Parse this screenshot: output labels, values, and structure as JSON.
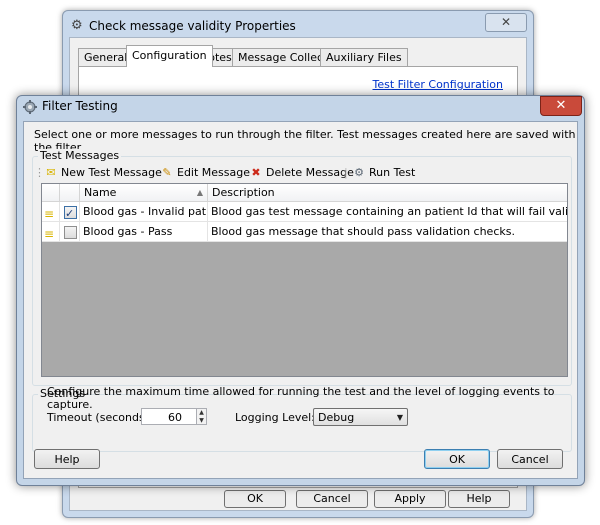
{
  "back_window": {
    "title": "Check message validity Properties",
    "close_glyph": "✕",
    "tabs": [
      "General",
      "Configuration",
      "Notes",
      "Message Collector",
      "Auxiliary Files"
    ],
    "link": "Test Filter Configuration",
    "buttons": [
      "OK",
      "Cancel",
      "Apply",
      "Help"
    ]
  },
  "dialog": {
    "title": "Filter Testing",
    "close_glyph": "✕",
    "intro": "Select one or more messages to run through the filter. Test messages created here are saved with the filter.",
    "test_messages_label": "Test Messages",
    "toolbar": {
      "new": "New Test Message",
      "edit": "Edit Message",
      "delete": "Delete Message",
      "run": "Run Test"
    },
    "grid": {
      "columns": [
        "Name",
        "Description"
      ],
      "rows": [
        {
          "checked": true,
          "name": "Blood gas - Invalid patient Id",
          "description": "Blood gas test message containing an patient Id that will fail validation rules."
        },
        {
          "checked": false,
          "name": "Blood gas - Pass",
          "description": "Blood gas message that should pass validation checks."
        }
      ]
    },
    "settings": {
      "label": "Settings",
      "description": "Configure the maximum time allowed for running the test and the level of logging events to capture.",
      "timeout_label": "Timeout (seconds):",
      "timeout_value": "60",
      "logging_label": "Logging Level:",
      "logging_value": "Debug"
    },
    "buttons": {
      "help": "Help",
      "ok": "OK",
      "cancel": "Cancel"
    }
  },
  "colors": {
    "title_bar": "#c4d5e8",
    "close_button": "#c94a3a",
    "link": "#0033cc",
    "grid_empty": "#a9a9a9"
  },
  "icons": [
    "gear-icon",
    "message-icon",
    "pencil-icon",
    "delete-icon",
    "run-icon",
    "sort-arrow-icon"
  ]
}
